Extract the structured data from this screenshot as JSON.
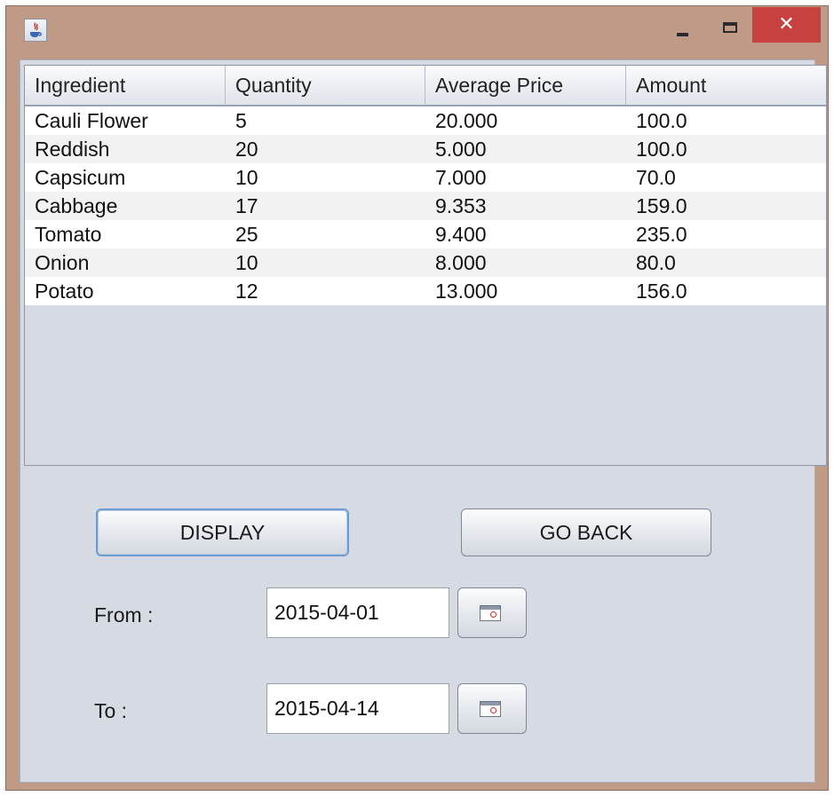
{
  "window": {
    "icon": "java-icon",
    "controls": {
      "minimize": "minimize-icon",
      "maximize": "maximize-icon",
      "close": "✕"
    },
    "colors": {
      "frame": "#bf9a86",
      "close": "#c7413e",
      "client": "#d5dae3"
    }
  },
  "table": {
    "columns": [
      "Ingredient",
      "Quantity",
      "Average Price",
      "Amount"
    ],
    "rows": [
      [
        "Cauli Flower",
        "5",
        "20.000",
        "100.0"
      ],
      [
        "Reddish",
        "20",
        "5.000",
        "100.0"
      ],
      [
        "Capsicum",
        "10",
        "7.000",
        "70.0"
      ],
      [
        "Cabbage",
        "17",
        "9.353",
        "159.0"
      ],
      [
        "Tomato",
        "25",
        "9.400",
        "235.0"
      ],
      [
        "Onion",
        "10",
        "8.000",
        "80.0"
      ],
      [
        "Potato",
        "12",
        "13.000",
        "156.0"
      ]
    ]
  },
  "buttons": {
    "display": "DISPLAY",
    "go_back": "GO BACK"
  },
  "date_from": {
    "label": "From :",
    "value": "2015-04-01",
    "picker_icon": "calendar-icon"
  },
  "date_to": {
    "label": "To :",
    "value": "2015-04-14",
    "picker_icon": "calendar-icon"
  }
}
